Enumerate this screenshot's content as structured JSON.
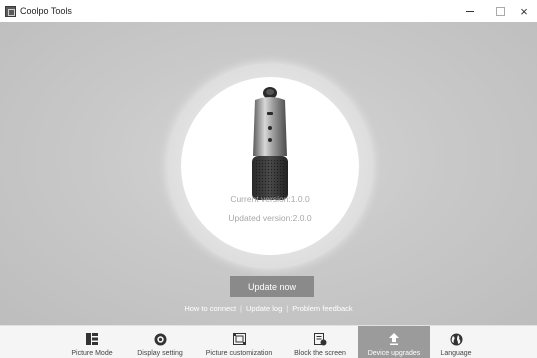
{
  "window": {
    "title": "Coolpo Tools",
    "close_glyph": "×"
  },
  "main": {
    "current_version": "Current version:1.0.0",
    "updated_version": "Updated version:2.0.0",
    "update_button": "Update now",
    "links": {
      "how_to_connect": "How to connect",
      "update_log": "Update log",
      "problem_feedback": "Problem feedback",
      "separator": "|"
    }
  },
  "nav": {
    "items": [
      {
        "label": "Picture Mode",
        "icon": "picture-mode-icon"
      },
      {
        "label": "Display setting",
        "icon": "display-setting-icon"
      },
      {
        "label": "Picture customization",
        "icon": "picture-customization-icon"
      },
      {
        "label": "Block the screen",
        "icon": "block-screen-icon"
      },
      {
        "label": "Device upgrades",
        "icon": "upgrade-arrow-icon",
        "active": true
      },
      {
        "label": "Language",
        "icon": "globe-icon"
      }
    ]
  },
  "colors": {
    "accent_active": "#9b9b9b",
    "button": "#8a8a8a"
  }
}
